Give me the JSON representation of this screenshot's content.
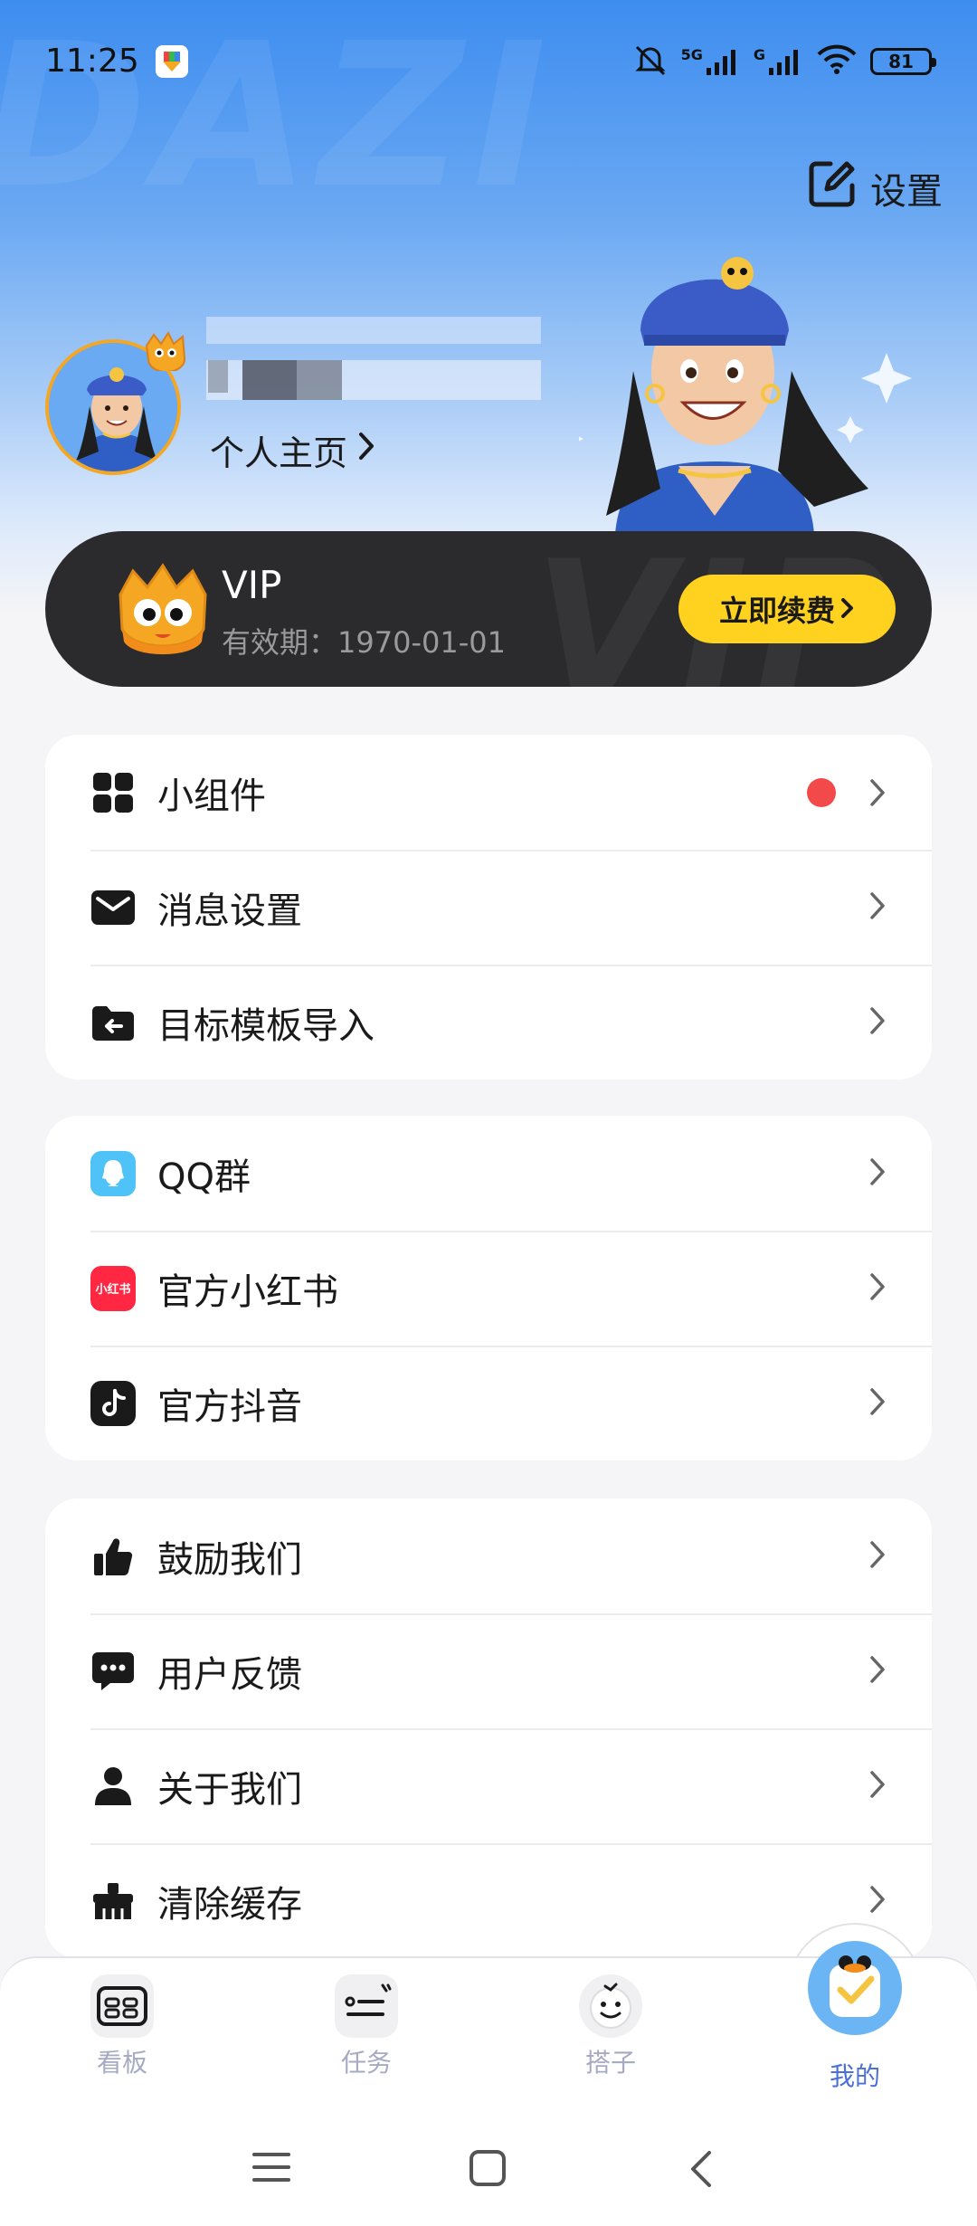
{
  "status_bar": {
    "time": "11:25",
    "network_1": "5G",
    "network_2": "G",
    "battery": "81"
  },
  "header": {
    "settings_label": "设置",
    "profile_link": "个人主页",
    "watermark": "DAZI"
  },
  "vip": {
    "title": "VIP",
    "expiry": "有效期：1970-01-01",
    "renew_button": "立即续费",
    "watermark": "VIP"
  },
  "menu_group_1": [
    {
      "label": "小组件",
      "icon": "grid-icon",
      "badge": true
    },
    {
      "label": "消息设置",
      "icon": "mail-icon",
      "badge": false
    },
    {
      "label": "目标模板导入",
      "icon": "folder-import-icon",
      "badge": false
    }
  ],
  "menu_group_2": [
    {
      "label": "QQ群",
      "icon": "qq-icon"
    },
    {
      "label": "官方小红书",
      "icon": "xiaohongshu-icon",
      "icon_text": "小红书"
    },
    {
      "label": "官方抖音",
      "icon": "douyin-icon"
    }
  ],
  "menu_group_3": [
    {
      "label": "鼓励我们",
      "icon": "thumbs-up-icon"
    },
    {
      "label": "用户反馈",
      "icon": "chat-bubble-icon"
    },
    {
      "label": "关于我们",
      "icon": "person-icon"
    },
    {
      "label": "清除缓存",
      "icon": "broom-icon"
    }
  ],
  "tabbar": [
    {
      "label": "看板",
      "icon": "dashboard-icon",
      "active": false
    },
    {
      "label": "任务",
      "icon": "task-list-icon",
      "active": false
    },
    {
      "label": "搭子",
      "icon": "buddy-face-icon",
      "active": false
    },
    {
      "label": "我的",
      "icon": "mascot-profile-icon",
      "active": true
    }
  ],
  "colors": {
    "accent_blue": "#4a6fd8",
    "vip_yellow": "#ffd21f",
    "badge_red": "#f24a4a"
  }
}
